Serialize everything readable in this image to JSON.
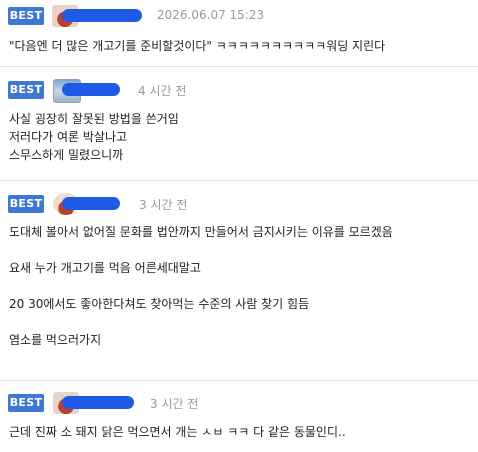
{
  "comments": [
    {
      "badge": "BEST",
      "time": "2026.06.07 15:23",
      "lines": [
        "\"다음엔 더 많은 개고기를 준비할것이다\" ㅋㅋㅋㅋㅋㅋㅋㅋㅋㅋ워딩 지린다"
      ]
    },
    {
      "badge": "BEST",
      "time": "4 시간 전",
      "lines": [
        "사실 굉장히 잘못된 방법을 쓴거임",
        "저러다가 여론 박살나고",
        "스무스하게 밀렸으니까"
      ]
    },
    {
      "badge": "BEST",
      "time": "3 시간 전",
      "lines": [
        "도대체 볼아서 없어질 문화를 법안까지 만들어서 금지시키는 이유를 모르겠음",
        "",
        "요새 누가 개고기를 먹음 어른세대말고",
        "",
        "20 30에서도 좋아한다쳐도 찾아먹는 수준의 사람 찾기 힘듬",
        "",
        "염소를 먹으러가지"
      ]
    },
    {
      "badge": "BEST",
      "time": "3 시간 전",
      "lines": [
        "근데 진짜 소 돼지 닭은 먹으면서 개는 ㅅㅂ ㅋㅋ 다 같은 동물인디.."
      ]
    }
  ]
}
